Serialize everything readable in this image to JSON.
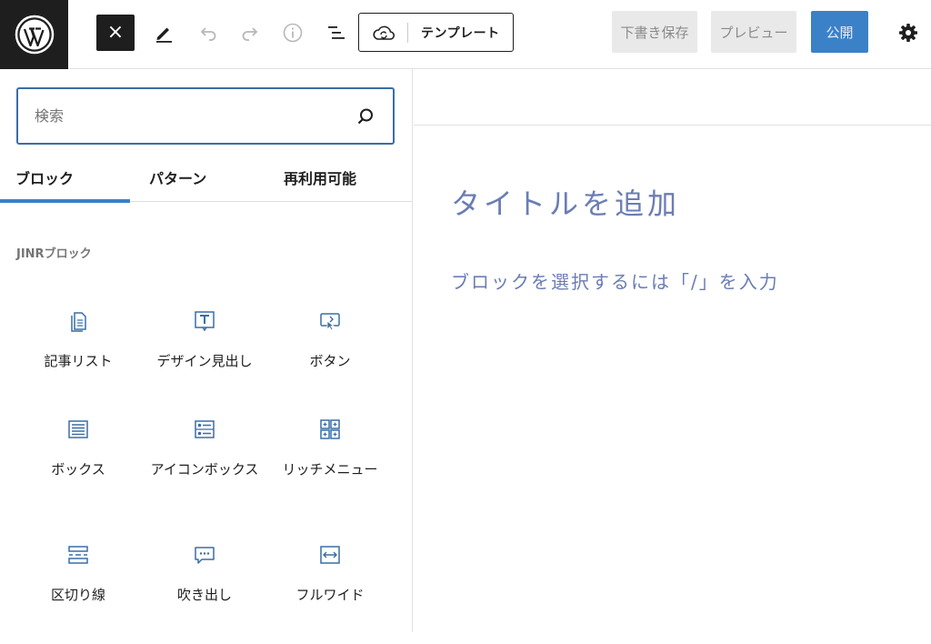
{
  "toolbar": {
    "close_label": "×",
    "template_label": "テンプレート",
    "save_draft_label": "下書き保存",
    "preview_label": "プレビュー",
    "publish_label": "公開"
  },
  "inserter": {
    "search_placeholder": "検索",
    "tabs": [
      {
        "label": "ブロック",
        "active": true
      },
      {
        "label": "パターン",
        "active": false
      },
      {
        "label": "再利用可能",
        "active": false
      }
    ],
    "category_label": "JINRブロック",
    "blocks": [
      {
        "label": "記事リスト",
        "icon": "document-list-icon"
      },
      {
        "label": "デザイン見出し",
        "icon": "heading-icon"
      },
      {
        "label": "ボタン",
        "icon": "button-cursor-icon"
      },
      {
        "label": "ボックス",
        "icon": "box-list-icon"
      },
      {
        "label": "アイコンボックス",
        "icon": "icon-box-icon"
      },
      {
        "label": "リッチメニュー",
        "icon": "rich-menu-icon"
      },
      {
        "label": "区切り線",
        "icon": "divider-icon"
      },
      {
        "label": "吹き出し",
        "icon": "speech-bubble-icon"
      },
      {
        "label": "フルワイド",
        "icon": "full-width-icon"
      }
    ]
  },
  "editor": {
    "title_placeholder": "タイトルを追加",
    "block_hint": "ブロックを選択するには「/」を入力"
  },
  "colors": {
    "accent": "#3a81c8",
    "icon_blue": "#3a6ea5",
    "placeholder": "#6b7db3",
    "logo_bg": "#1e1e1e"
  }
}
